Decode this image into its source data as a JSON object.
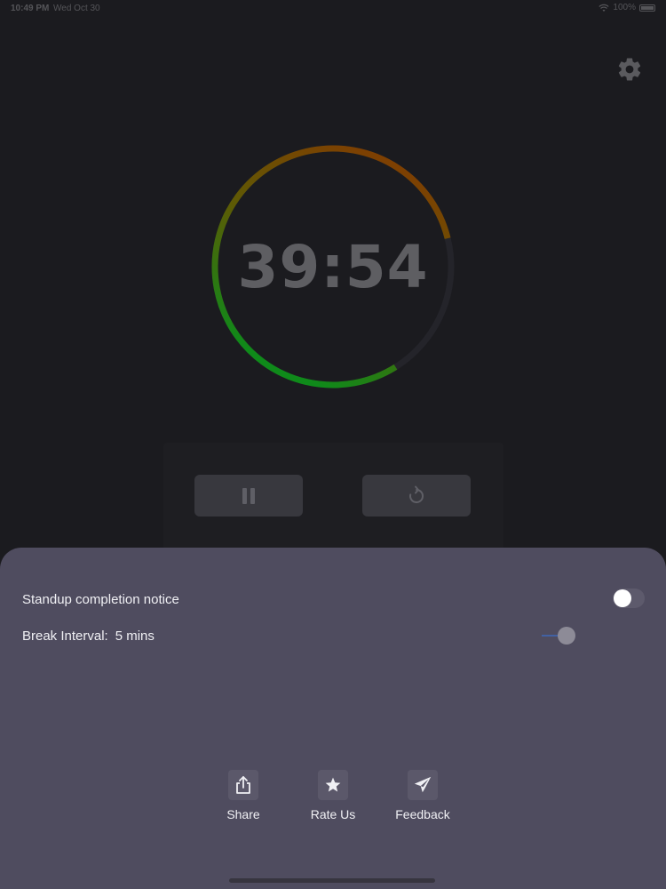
{
  "status_bar": {
    "time": "10:49 PM",
    "date": "Wed Oct 30",
    "battery": "100%"
  },
  "timer": {
    "display": "39:54",
    "progress": 0.8,
    "ring_colors": [
      "#8a3500",
      "#6a5a00",
      "#0f8a1a"
    ]
  },
  "controls": {
    "pause_icon": "pause-icon",
    "reset_icon": "reset-icon"
  },
  "settings": {
    "icon": "gear-icon",
    "standup_notice_label": "Standup completion notice",
    "standup_notice_on": false,
    "break_interval_label": "Break Interval:",
    "break_interval_value": "5 mins"
  },
  "actions": [
    {
      "label": "Share",
      "icon": "share-icon"
    },
    {
      "label": "Rate Us",
      "icon": "star-icon"
    },
    {
      "label": "Feedback",
      "icon": "paper-plane-icon"
    }
  ],
  "colors": {
    "background": "#1b1b1f",
    "sheet": "#4f4c5f",
    "button": "#38383e"
  }
}
